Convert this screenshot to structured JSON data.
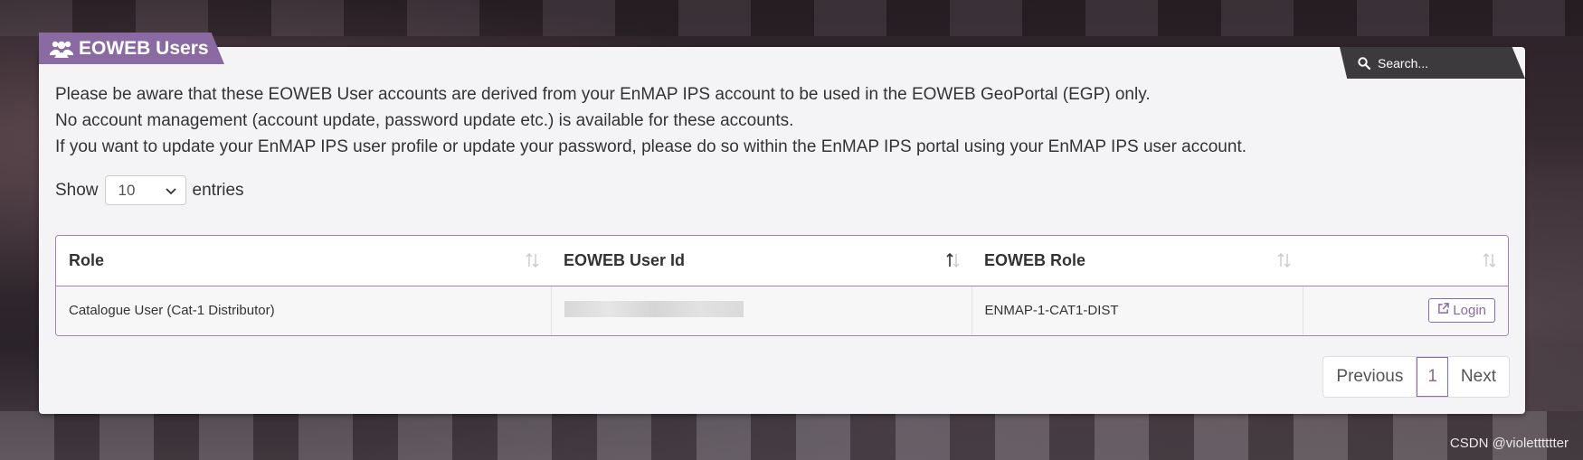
{
  "title": {
    "text": "EOWEB Users",
    "icon": "users-icon"
  },
  "search": {
    "placeholder": "Search...",
    "icon": "search-icon"
  },
  "notice": {
    "line1": "Please be aware that these EOWEB User accounts are derived from your EnMAP IPS account to be used in the EOWEB GeoPortal (EGP) only.",
    "line2": "No account management (account update, password update etc.) is available for these accounts.",
    "line3": "If you want to update your EnMAP IPS user profile or update your password, please do so within the EnMAP IPS portal using your EnMAP IPS user account."
  },
  "length": {
    "show_label": "Show",
    "value": "10",
    "entries_label": "entries"
  },
  "table": {
    "columns": [
      "Role",
      "EOWEB User Id",
      "EOWEB Role",
      ""
    ],
    "rows": [
      {
        "role": "Catalogue User (Cat-1 Distributor)",
        "user_id": "",
        "eoweb_role": "ENMAP-1-CAT1-DIST",
        "action": "Login"
      }
    ]
  },
  "pagination": {
    "previous": "Previous",
    "current": "1",
    "next": "Next"
  },
  "watermark": "CSDN @violetttttter",
  "colors": {
    "accent": "#8a6aa3",
    "panel": "#f4f4f6",
    "search_bg": "#3d3a3d"
  }
}
